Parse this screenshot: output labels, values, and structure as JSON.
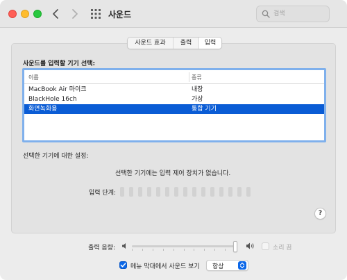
{
  "window": {
    "title": "사운드",
    "search": {
      "placeholder": "검색",
      "value": ""
    }
  },
  "tabs": [
    {
      "label": "사운드 효과",
      "selected": false
    },
    {
      "label": "출력",
      "selected": false
    },
    {
      "label": "입력",
      "selected": true
    }
  ],
  "input_panel": {
    "section_label": "사운드를 입력할 기기 선택:",
    "table": {
      "columns": [
        "이름",
        "종류"
      ],
      "rows": [
        {
          "name": "MacBook Air 마이크",
          "type": "내장",
          "selected": false
        },
        {
          "name": "BlackHole 16ch",
          "type": "가상",
          "selected": false
        },
        {
          "name": "화면녹화용",
          "type": "통합 기기",
          "selected": true
        }
      ]
    },
    "settings_label": "선택한 기기에 대한 설정:",
    "no_controls_text": "선택한 기기에는 입력 제어 장치가 없습니다.",
    "input_level_label": "입력 단계:",
    "input_level_bars": 15,
    "input_level_value": 0,
    "help_label": "?"
  },
  "output_volume": {
    "label": "출력 음량:",
    "level": 1.0,
    "mute_label": "소리 끔",
    "mute_checked": false
  },
  "menubar": {
    "label": "메뉴 막대에서 사운드 보기",
    "checked": true,
    "select_value": "항상"
  },
  "colors": {
    "selection": "#0a5cd5",
    "accent": "#0b67e8",
    "focus_ring": "#7fb0ec",
    "traffic_red": "#ff5f57",
    "traffic_yellow": "#febc2e",
    "traffic_green": "#28c840"
  },
  "icons": {
    "back": "chevron-left-icon",
    "forward": "chevron-right-icon",
    "grid": "grid-icon",
    "search": "search-icon",
    "speaker_low": "speaker-low-icon",
    "speaker_high": "speaker-high-icon",
    "checkmark": "checkmark-icon",
    "stepper": "up-down-chevron-icon"
  }
}
